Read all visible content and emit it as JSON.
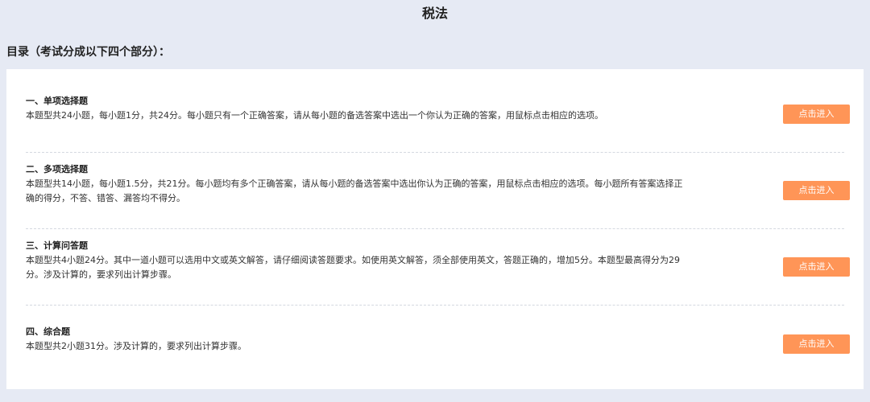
{
  "page": {
    "title": "税法",
    "toc_heading": "目录（考试分成以下四个部分）："
  },
  "sections": [
    {
      "title": "一、单项选择题",
      "description": "本题型共24小题，每小题1分，共24分。每小题只有一个正确答案，请从每小题的备选答案中选出一个你认为正确的答案，用鼠标点击相应的选项。",
      "button_label": "点击进入"
    },
    {
      "title": "二、多项选择题",
      "description": "本题型共14小题，每小题1.5分，共21分。每小题均有多个正确答案，请从每小题的备选答案中选出你认为正确的答案，用鼠标点击相应的选项。每小题所有答案选择正确的得分，不答、错答、漏答均不得分。",
      "button_label": "点击进入"
    },
    {
      "title": "三、计算问答题",
      "description": "本题型共4小题24分。其中一道小题可以选用中文或英文解答，请仔细阅读答题要求。如使用英文解答，须全部使用英文，答题正确的，增加5分。本题型最高得分为29分。涉及计算的，要求列出计算步骤。",
      "button_label": "点击进入"
    },
    {
      "title": "四、综合题",
      "description": "本题型共2小题31分。涉及计算的，要求列出计算步骤。",
      "button_label": "点击进入"
    }
  ],
  "colors": {
    "background": "#e6eaf4",
    "panel": "#ffffff",
    "accent_button": "#ff9557"
  }
}
